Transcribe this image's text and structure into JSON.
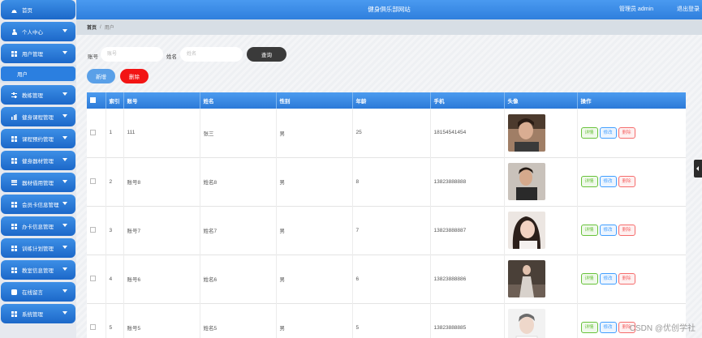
{
  "app": {
    "title": "健身俱乐部网站",
    "admin_label": "管理员 admin",
    "logout_label": "退出登录"
  },
  "sidebar": {
    "items": [
      {
        "label": "首页",
        "icon": "home-icon"
      },
      {
        "label": "个人中心",
        "icon": "user-icon"
      },
      {
        "label": "用户管理",
        "icon": "grid-icon"
      },
      {
        "label": "教练管理",
        "icon": "sliders-icon"
      },
      {
        "label": "健身课程管理",
        "icon": "bar-chart-icon"
      },
      {
        "label": "课程预约管理",
        "icon": "grid-icon"
      },
      {
        "label": "健身器材管理",
        "icon": "grid-icon"
      },
      {
        "label": "器材借用管理",
        "icon": "list-icon"
      },
      {
        "label": "会员卡信息管理",
        "icon": "grid-icon"
      },
      {
        "label": "办卡信息管理",
        "icon": "grid-icon"
      },
      {
        "label": "训练计划管理",
        "icon": "grid-icon"
      },
      {
        "label": "教室信息管理",
        "icon": "grid-icon"
      },
      {
        "label": "在线留言",
        "icon": "chat-icon"
      },
      {
        "label": "系统管理",
        "icon": "grid-icon"
      }
    ],
    "sub_item": "用户"
  },
  "breadcrumb": {
    "home": "首页",
    "separator": "/",
    "current": "用户"
  },
  "search": {
    "account_label": "账号",
    "account_placeholder": "账号",
    "name_label": "姓名",
    "name_placeholder": "姓名",
    "query_button": "查询"
  },
  "actions": {
    "add_button": "新增",
    "delete_button": "删除"
  },
  "table": {
    "columns": [
      "",
      "索引",
      "账号",
      "姓名",
      "性别",
      "年龄",
      "手机",
      "头像",
      "操作"
    ],
    "rows": [
      {
        "index": "1",
        "account": "111",
        "name": "张三",
        "gender": "男",
        "age": "25",
        "phone": "18154541454"
      },
      {
        "index": "2",
        "account": "账号8",
        "name": "姓名8",
        "gender": "男",
        "age": "8",
        "phone": "13823888888"
      },
      {
        "index": "3",
        "account": "账号7",
        "name": "姓名7",
        "gender": "男",
        "age": "7",
        "phone": "13823888887"
      },
      {
        "index": "4",
        "account": "账号6",
        "name": "姓名6",
        "gender": "男",
        "age": "6",
        "phone": "13823888886"
      },
      {
        "index": "5",
        "account": "账号5",
        "name": "姓名5",
        "gender": "男",
        "age": "5",
        "phone": "13823888885"
      }
    ],
    "op_detail": "详情",
    "op_edit": "修改",
    "op_remove": "删除"
  },
  "watermark": "CSDN @优创学社",
  "colors": {
    "nav_blue": "#1c68c9",
    "delete_red": "#f21414",
    "query_dark": "#3a3a3a"
  }
}
